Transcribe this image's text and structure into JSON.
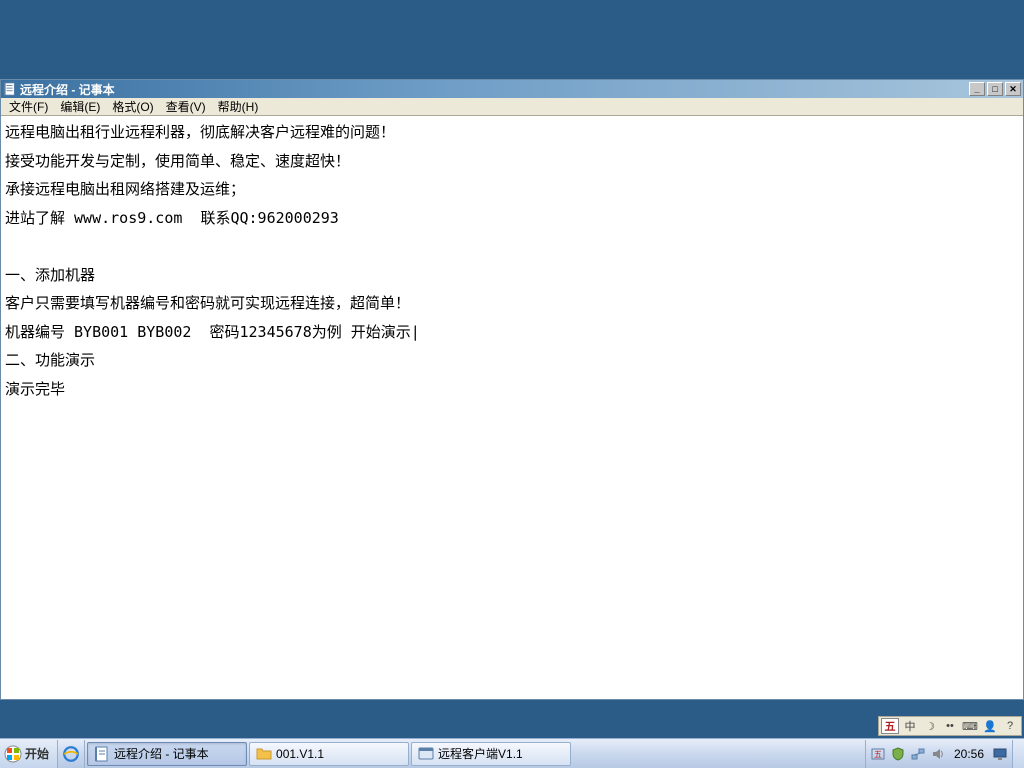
{
  "window": {
    "title": "远程介绍 - 记事本",
    "controls": {
      "minimize": "_",
      "maximize": "□",
      "close": "✕"
    }
  },
  "menu": {
    "file": "文件(F)",
    "edit": "编辑(E)",
    "format": "格式(O)",
    "view": "查看(V)",
    "help": "帮助(H)"
  },
  "content": "远程电脑出租行业远程利器，彻底解决客户远程难的问题！\n接受功能开发与定制，使用简单、稳定、速度超快！\n承接远程电脑出租网络搭建及运维；\n进站了解 www.ros9.com  联系QQ:962000293\n\n一、添加机器\n客户只需要填写机器编号和密码就可实现远程连接，超简单！\n机器编号 BYB001 BYB002  密码12345678为例 开始演示|\n二、功能演示\n演示完毕",
  "langbar": {
    "ime": "五",
    "ch": "中",
    "moon": "☽",
    "dot": "••",
    "kbd": "⌨",
    "user": "👤",
    "help": "?"
  },
  "taskbar": {
    "start": "开始",
    "tasks": [
      {
        "icon": "notepad",
        "label": "远程介绍 - 记事本",
        "active": true
      },
      {
        "icon": "folder",
        "label": "001.V1.1",
        "active": false
      },
      {
        "icon": "app",
        "label": "远程客户端V1.1",
        "active": false
      }
    ],
    "clock": "20:56"
  }
}
